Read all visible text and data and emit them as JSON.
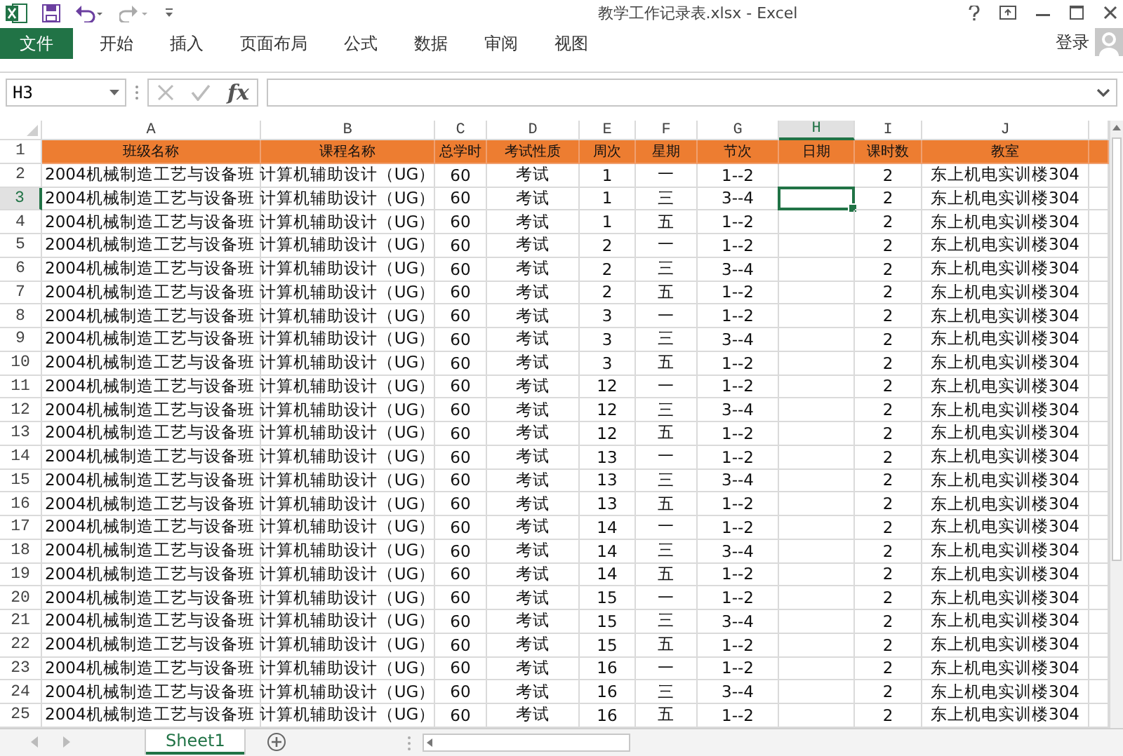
{
  "window": {
    "title": "教学工作记录表.xlsx - Excel"
  },
  "ribbon": {
    "tabs": [
      {
        "label": "文件",
        "kind": "file",
        "selected": false
      },
      {
        "label": "开始",
        "kind": "tab",
        "selected": false
      },
      {
        "label": "插入",
        "kind": "tab",
        "selected": false
      },
      {
        "label": "页面布局",
        "kind": "tab",
        "selected": false
      },
      {
        "label": "公式",
        "kind": "tab",
        "selected": false
      },
      {
        "label": "数据",
        "kind": "tab",
        "selected": false
      },
      {
        "label": "审阅",
        "kind": "tab",
        "selected": false
      },
      {
        "label": "视图",
        "kind": "tab",
        "selected": false
      }
    ],
    "sign_in": "登录"
  },
  "formula_bar": {
    "name_box": "H3",
    "function_button": "fx"
  },
  "columns": [
    {
      "letter": "A",
      "selected": false
    },
    {
      "letter": "B",
      "selected": false
    },
    {
      "letter": "C",
      "selected": false
    },
    {
      "letter": "D",
      "selected": false
    },
    {
      "letter": "E",
      "selected": false
    },
    {
      "letter": "F",
      "selected": false
    },
    {
      "letter": "G",
      "selected": false
    },
    {
      "letter": "H",
      "selected": true
    },
    {
      "letter": "I",
      "selected": false
    },
    {
      "letter": "J",
      "selected": false
    }
  ],
  "rows": [
    {
      "number": "1",
      "kind": "header",
      "selected": false,
      "cells": {
        "A": "班级名称",
        "B": "课程名称",
        "C": "总学时",
        "D": "考试性质",
        "E": "周次",
        "F": "星期",
        "G": "节次",
        "H": "日期",
        "I": "课时数",
        "J": "教室"
      }
    },
    {
      "number": "2",
      "kind": "data",
      "selected": false,
      "cells": {
        "A": "2004机械制造工艺与设备班",
        "B": "计算机辅助设计（UG）",
        "C": "60",
        "D": "考试",
        "E": "1",
        "F": "一",
        "G": "1--2",
        "I": "2",
        "J": "东上机电实训楼304"
      }
    },
    {
      "number": "3",
      "kind": "data",
      "selected": true,
      "cells": {
        "A": "2004机械制造工艺与设备班",
        "B": "计算机辅助设计（UG）",
        "C": "60",
        "D": "考试",
        "E": "1",
        "F": "三",
        "G": "3--4",
        "I": "2",
        "J": "东上机电实训楼304"
      }
    },
    {
      "number": "4",
      "kind": "data",
      "selected": false,
      "cells": {
        "A": "2004机械制造工艺与设备班",
        "B": "计算机辅助设计（UG）",
        "C": "60",
        "D": "考试",
        "E": "1",
        "F": "五",
        "G": "1--2",
        "I": "2",
        "J": "东上机电实训楼304"
      }
    },
    {
      "number": "5",
      "kind": "data",
      "selected": false,
      "cells": {
        "A": "2004机械制造工艺与设备班",
        "B": "计算机辅助设计（UG）",
        "C": "60",
        "D": "考试",
        "E": "2",
        "F": "一",
        "G": "1--2",
        "I": "2",
        "J": "东上机电实训楼304"
      }
    },
    {
      "number": "6",
      "kind": "data",
      "selected": false,
      "cells": {
        "A": "2004机械制造工艺与设备班",
        "B": "计算机辅助设计（UG）",
        "C": "60",
        "D": "考试",
        "E": "2",
        "F": "三",
        "G": "3--4",
        "I": "2",
        "J": "东上机电实训楼304"
      }
    },
    {
      "number": "7",
      "kind": "data",
      "selected": false,
      "cells": {
        "A": "2004机械制造工艺与设备班",
        "B": "计算机辅助设计（UG）",
        "C": "60",
        "D": "考试",
        "E": "2",
        "F": "五",
        "G": "1--2",
        "I": "2",
        "J": "东上机电实训楼304"
      }
    },
    {
      "number": "8",
      "kind": "data",
      "selected": false,
      "cells": {
        "A": "2004机械制造工艺与设备班",
        "B": "计算机辅助设计（UG）",
        "C": "60",
        "D": "考试",
        "E": "3",
        "F": "一",
        "G": "1--2",
        "I": "2",
        "J": "东上机电实训楼304"
      }
    },
    {
      "number": "9",
      "kind": "data",
      "selected": false,
      "cells": {
        "A": "2004机械制造工艺与设备班",
        "B": "计算机辅助设计（UG）",
        "C": "60",
        "D": "考试",
        "E": "3",
        "F": "三",
        "G": "3--4",
        "I": "2",
        "J": "东上机电实训楼304"
      }
    },
    {
      "number": "10",
      "kind": "data",
      "selected": false,
      "cells": {
        "A": "2004机械制造工艺与设备班",
        "B": "计算机辅助设计（UG）",
        "C": "60",
        "D": "考试",
        "E": "3",
        "F": "五",
        "G": "1--2",
        "I": "2",
        "J": "东上机电实训楼304"
      }
    },
    {
      "number": "11",
      "kind": "data",
      "selected": false,
      "cells": {
        "A": "2004机械制造工艺与设备班",
        "B": "计算机辅助设计（UG）",
        "C": "60",
        "D": "考试",
        "E": "12",
        "F": "一",
        "G": "1--2",
        "I": "2",
        "J": "东上机电实训楼304"
      }
    },
    {
      "number": "12",
      "kind": "data",
      "selected": false,
      "cells": {
        "A": "2004机械制造工艺与设备班",
        "B": "计算机辅助设计（UG）",
        "C": "60",
        "D": "考试",
        "E": "12",
        "F": "三",
        "G": "3--4",
        "I": "2",
        "J": "东上机电实训楼304"
      }
    },
    {
      "number": "13",
      "kind": "data",
      "selected": false,
      "cells": {
        "A": "2004机械制造工艺与设备班",
        "B": "计算机辅助设计（UG）",
        "C": "60",
        "D": "考试",
        "E": "12",
        "F": "五",
        "G": "1--2",
        "I": "2",
        "J": "东上机电实训楼304"
      }
    },
    {
      "number": "14",
      "kind": "data",
      "selected": false,
      "cells": {
        "A": "2004机械制造工艺与设备班",
        "B": "计算机辅助设计（UG）",
        "C": "60",
        "D": "考试",
        "E": "13",
        "F": "一",
        "G": "1--2",
        "I": "2",
        "J": "东上机电实训楼304"
      }
    },
    {
      "number": "15",
      "kind": "data",
      "selected": false,
      "cells": {
        "A": "2004机械制造工艺与设备班",
        "B": "计算机辅助设计（UG）",
        "C": "60",
        "D": "考试",
        "E": "13",
        "F": "三",
        "G": "3--4",
        "I": "2",
        "J": "东上机电实训楼304"
      }
    },
    {
      "number": "16",
      "kind": "data",
      "selected": false,
      "cells": {
        "A": "2004机械制造工艺与设备班",
        "B": "计算机辅助设计（UG）",
        "C": "60",
        "D": "考试",
        "E": "13",
        "F": "五",
        "G": "1--2",
        "I": "2",
        "J": "东上机电实训楼304"
      }
    },
    {
      "number": "17",
      "kind": "data",
      "selected": false,
      "cells": {
        "A": "2004机械制造工艺与设备班",
        "B": "计算机辅助设计（UG）",
        "C": "60",
        "D": "考试",
        "E": "14",
        "F": "一",
        "G": "1--2",
        "I": "2",
        "J": "东上机电实训楼304"
      }
    },
    {
      "number": "18",
      "kind": "data",
      "selected": false,
      "cells": {
        "A": "2004机械制造工艺与设备班",
        "B": "计算机辅助设计（UG）",
        "C": "60",
        "D": "考试",
        "E": "14",
        "F": "三",
        "G": "3--4",
        "I": "2",
        "J": "东上机电实训楼304"
      }
    },
    {
      "number": "19",
      "kind": "data",
      "selected": false,
      "cells": {
        "A": "2004机械制造工艺与设备班",
        "B": "计算机辅助设计（UG）",
        "C": "60",
        "D": "考试",
        "E": "14",
        "F": "五",
        "G": "1--2",
        "I": "2",
        "J": "东上机电实训楼304"
      }
    },
    {
      "number": "20",
      "kind": "data",
      "selected": false,
      "cells": {
        "A": "2004机械制造工艺与设备班",
        "B": "计算机辅助设计（UG）",
        "C": "60",
        "D": "考试",
        "E": "15",
        "F": "一",
        "G": "1--2",
        "I": "2",
        "J": "东上机电实训楼304"
      }
    },
    {
      "number": "21",
      "kind": "data",
      "selected": false,
      "cells": {
        "A": "2004机械制造工艺与设备班",
        "B": "计算机辅助设计（UG）",
        "C": "60",
        "D": "考试",
        "E": "15",
        "F": "三",
        "G": "3--4",
        "I": "2",
        "J": "东上机电实训楼304"
      }
    },
    {
      "number": "22",
      "kind": "data",
      "selected": false,
      "cells": {
        "A": "2004机械制造工艺与设备班",
        "B": "计算机辅助设计（UG）",
        "C": "60",
        "D": "考试",
        "E": "15",
        "F": "五",
        "G": "1--2",
        "I": "2",
        "J": "东上机电实训楼304"
      }
    },
    {
      "number": "23",
      "kind": "data",
      "selected": false,
      "cells": {
        "A": "2004机械制造工艺与设备班",
        "B": "计算机辅助设计（UG）",
        "C": "60",
        "D": "考试",
        "E": "16",
        "F": "一",
        "G": "1--2",
        "I": "2",
        "J": "东上机电实训楼304"
      }
    },
    {
      "number": "24",
      "kind": "data",
      "selected": false,
      "cells": {
        "A": "2004机械制造工艺与设备班",
        "B": "计算机辅助设计（UG）",
        "C": "60",
        "D": "考试",
        "E": "16",
        "F": "三",
        "G": "3--4",
        "I": "2",
        "J": "东上机电实训楼304"
      }
    },
    {
      "number": "25",
      "kind": "data",
      "selected": false,
      "cells": {
        "A": "2004机械制造工艺与设备班",
        "B": "计算机辅助设计（UG）",
        "C": "60",
        "D": "考试",
        "E": "16",
        "F": "五",
        "G": "1--2",
        "I": "2",
        "J": "东上机电实训楼304"
      }
    }
  ],
  "sheet_tabs": [
    {
      "label": "Sheet1",
      "selected": true
    }
  ]
}
